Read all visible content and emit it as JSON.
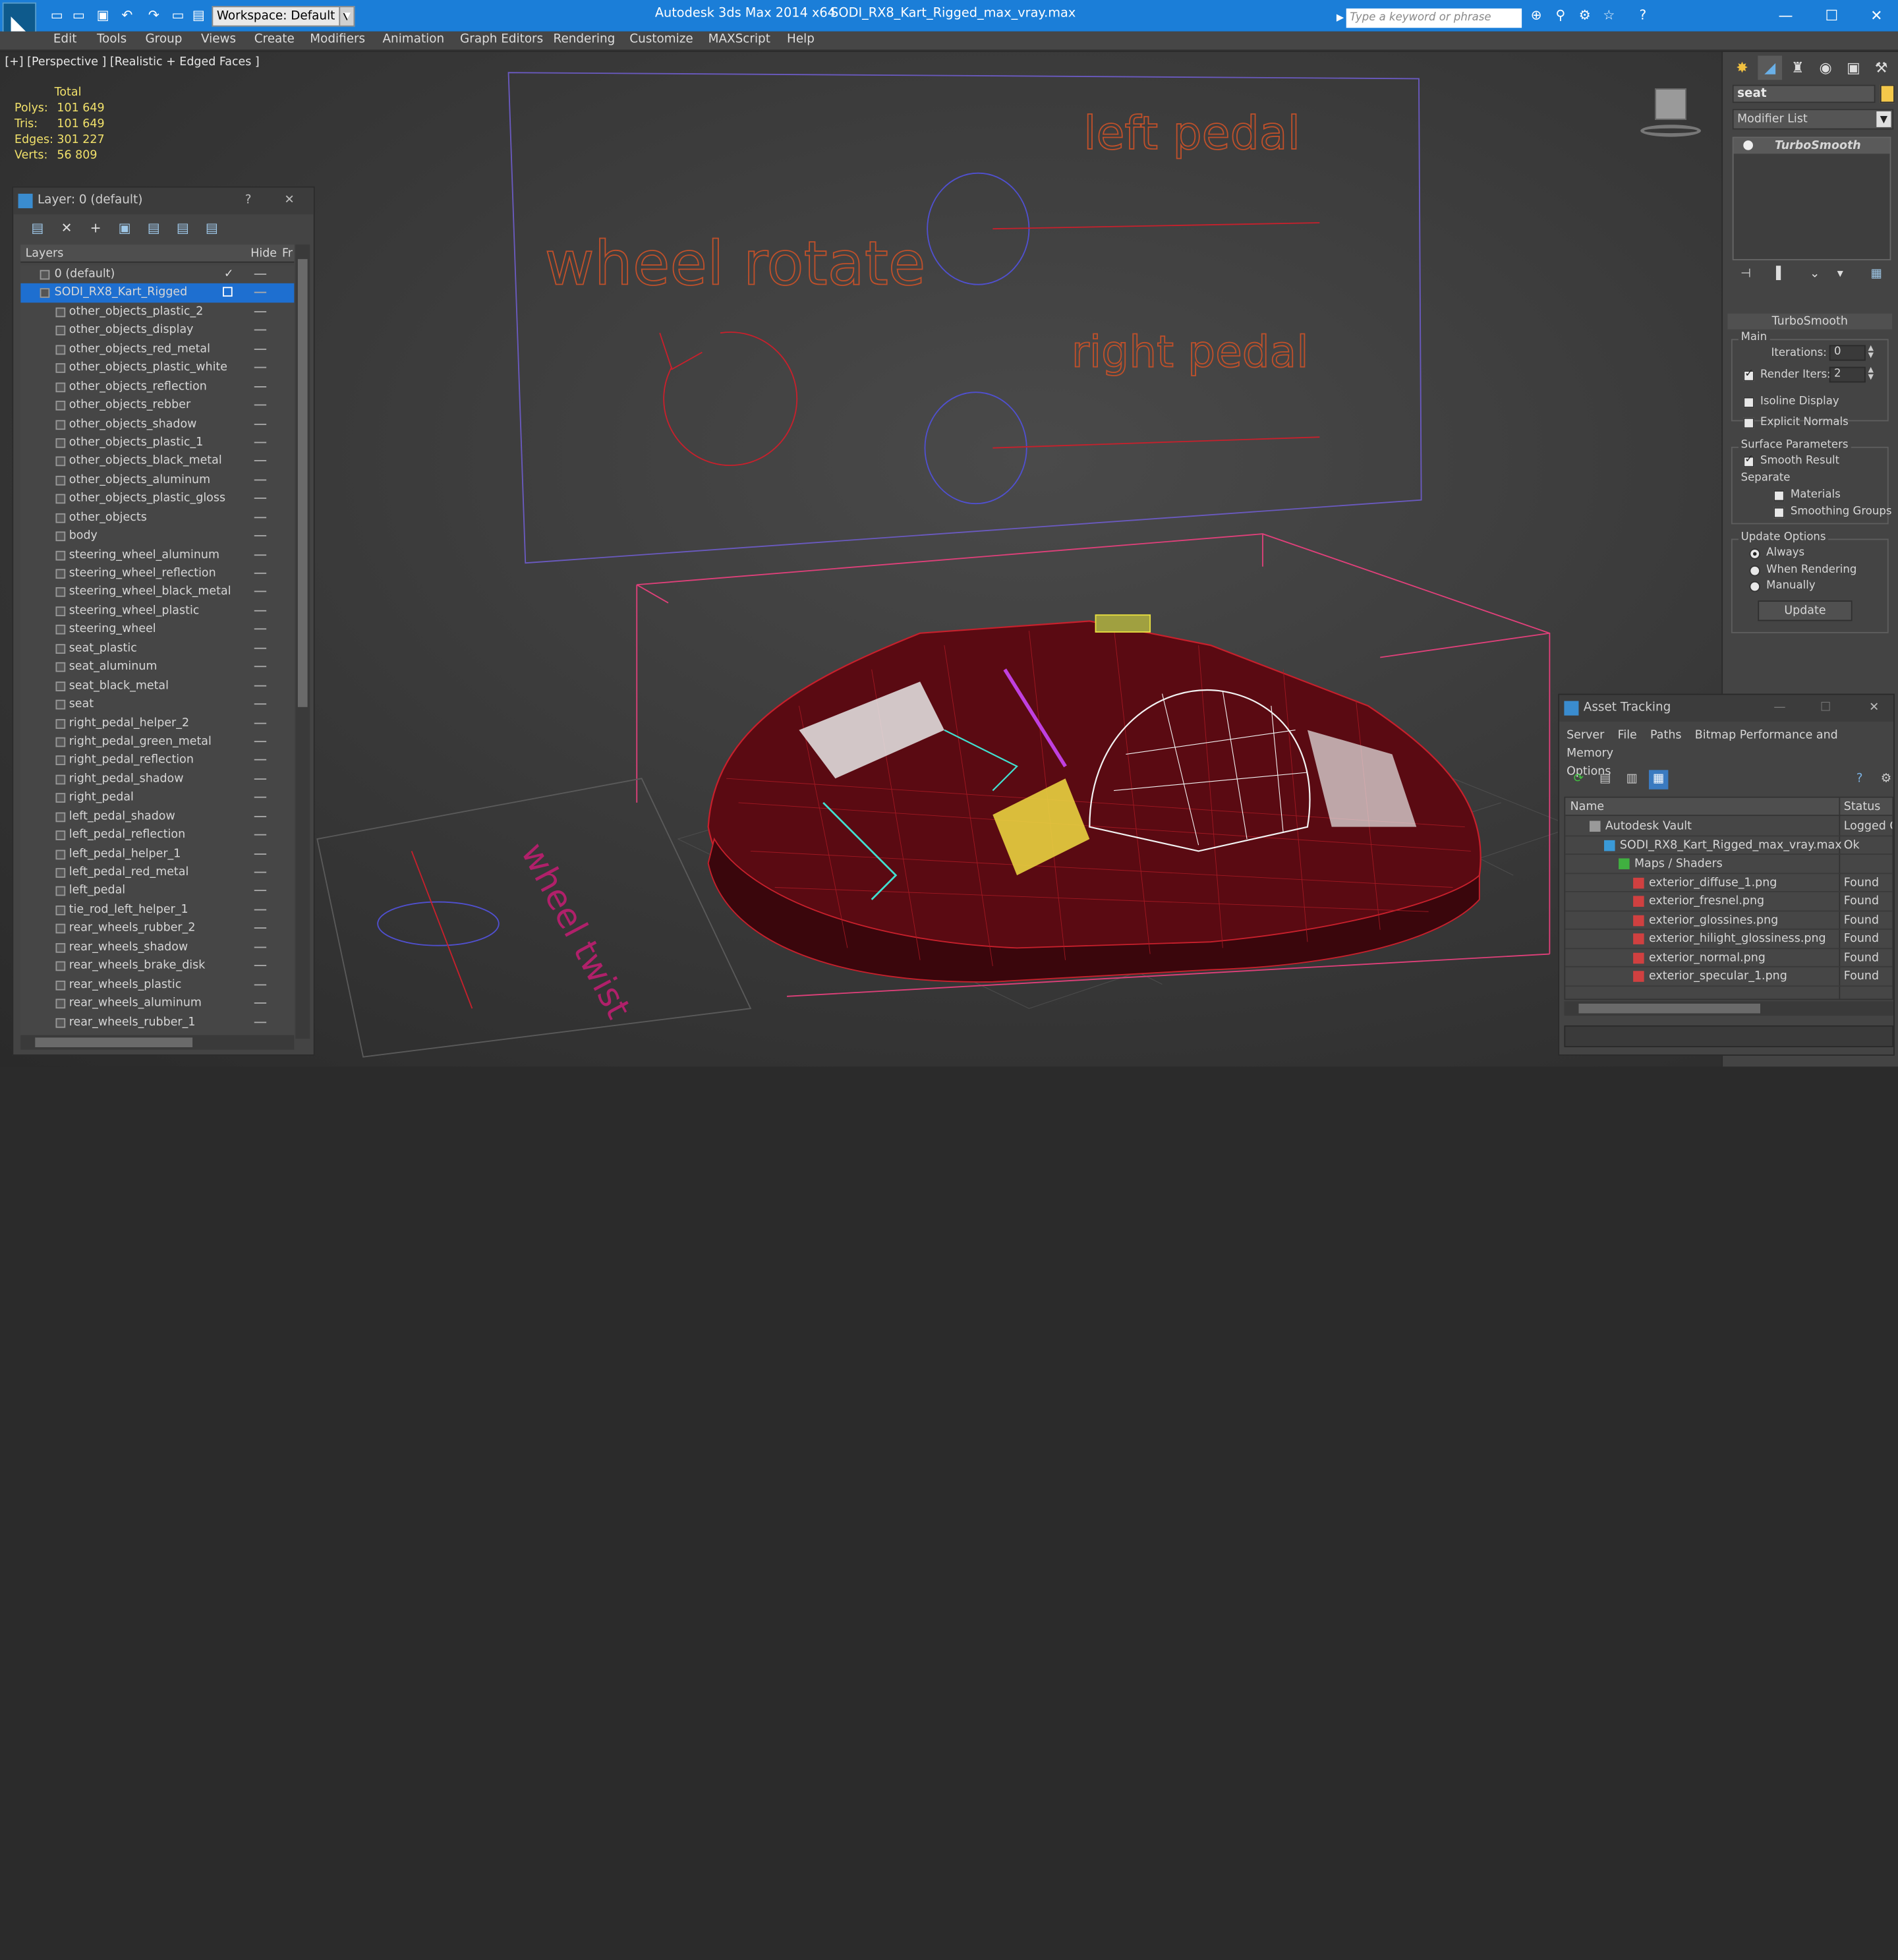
{
  "app": {
    "title": "Autodesk 3ds Max  2014 x64",
    "file": "SODI_RX8_Kart_Rigged_max_vray.max",
    "workspace": "Workspace: Default",
    "search_placeholder": "Type a keyword or phrase"
  },
  "menu": [
    "Edit",
    "Tools",
    "Group",
    "Views",
    "Create",
    "Modifiers",
    "Animation",
    "Graph Editors",
    "Rendering",
    "Customize",
    "MAXScript",
    "Help"
  ],
  "viewport": {
    "label": "[+] [Perspective ] [Realistic + Edged Faces ]",
    "stats_header": "Total",
    "stats": [
      {
        "label": "Polys:",
        "value": "101 649"
      },
      {
        "label": "Tris:",
        "value": "101 649"
      },
      {
        "label": "Edges:",
        "value": "301 227"
      },
      {
        "label": "Verts:",
        "value": "56 809"
      }
    ],
    "rig_labels": {
      "left_pedal": "left pedal",
      "right_pedal": "right pedal",
      "wheel_rotate": "wheel rotate",
      "floor_text": "wheel twist"
    }
  },
  "layer_panel": {
    "title": "Layer: 0 (default)",
    "help": "?",
    "col_layers": "Layers",
    "col_hide": "Hide",
    "col_freeze": "Fr",
    "layers": [
      {
        "name": "0 (default)",
        "level": 0,
        "current": true
      },
      {
        "name": "SODI_RX8_Kart_Rigged",
        "level": 0,
        "selected": true
      },
      {
        "name": "other_objects_plastic_2",
        "level": 1
      },
      {
        "name": "other_objects_display",
        "level": 1
      },
      {
        "name": "other_objects_red_metal",
        "level": 1
      },
      {
        "name": "other_objects_plastic_white",
        "level": 1
      },
      {
        "name": "other_objects_reflection",
        "level": 1
      },
      {
        "name": "other_objects_rebber",
        "level": 1
      },
      {
        "name": "other_objects_shadow",
        "level": 1
      },
      {
        "name": "other_objects_plastic_1",
        "level": 1
      },
      {
        "name": "other_objects_black_metal",
        "level": 1
      },
      {
        "name": "other_objects_aluminum",
        "level": 1
      },
      {
        "name": "other_objects_plastic_gloss",
        "level": 1
      },
      {
        "name": "other_objects",
        "level": 1
      },
      {
        "name": "body",
        "level": 1
      },
      {
        "name": "steering_wheel_aluminum",
        "level": 1
      },
      {
        "name": "steering_wheel_reflection",
        "level": 1
      },
      {
        "name": "steering_wheel_black_metal",
        "level": 1
      },
      {
        "name": "steering_wheel_plastic",
        "level": 1
      },
      {
        "name": "steering_wheel",
        "level": 1
      },
      {
        "name": "seat_plastic",
        "level": 1
      },
      {
        "name": "seat_aluminum",
        "level": 1
      },
      {
        "name": "seat_black_metal",
        "level": 1
      },
      {
        "name": "seat",
        "level": 1
      },
      {
        "name": "right_pedal_helper_2",
        "level": 1
      },
      {
        "name": "right_pedal_green_metal",
        "level": 1
      },
      {
        "name": "right_pedal_reflection",
        "level": 1
      },
      {
        "name": "right_pedal_shadow",
        "level": 1
      },
      {
        "name": "right_pedal",
        "level": 1
      },
      {
        "name": "left_pedal_shadow",
        "level": 1
      },
      {
        "name": "left_pedal_reflection",
        "level": 1
      },
      {
        "name": "left_pedal_helper_1",
        "level": 1
      },
      {
        "name": "left_pedal_red_metal",
        "level": 1
      },
      {
        "name": "left_pedal",
        "level": 1
      },
      {
        "name": "tie_rod_left_helper_1",
        "level": 1
      },
      {
        "name": "rear_wheels_rubber_2",
        "level": 1
      },
      {
        "name": "rear_wheels_shadow",
        "level": 1
      },
      {
        "name": "rear_wheels_brake_disk",
        "level": 1
      },
      {
        "name": "rear_wheels_plastic",
        "level": 1
      },
      {
        "name": "rear_wheels_aluminum",
        "level": 1
      },
      {
        "name": "rear_wheels_rubber_1",
        "level": 1
      }
    ]
  },
  "command_panel": {
    "object_name": "seat",
    "modifier_list": "Modifier List",
    "stack_item": "TurboSmooth",
    "rollout_title": "TurboSmooth",
    "main_label": "Main",
    "iterations_label": "Iterations:",
    "iterations_value": "0",
    "render_iters_label": "Render Iters:",
    "render_iters_value": "2",
    "isoline_label": "Isoline Display",
    "explicit_normals_label": "Explicit Normals",
    "surface_params_label": "Surface Parameters",
    "smooth_result_label": "Smooth Result",
    "separate_label": "Separate",
    "materials_label": "Materials",
    "smoothing_groups_label": "Smoothing Groups",
    "update_options_label": "Update Options",
    "always_label": "Always",
    "when_rendering_label": "When Rendering",
    "manually_label": "Manually",
    "update_button": "Update"
  },
  "asset_panel": {
    "title": "Asset Tracking",
    "menu": [
      "Server",
      "File",
      "Paths",
      "Bitmap Performance and Memory"
    ],
    "menu2": "Options",
    "col_name": "Name",
    "col_status": "Status",
    "rows": [
      {
        "name": "Autodesk Vault",
        "status": "Logged O",
        "level": 0,
        "kind": "vault"
      },
      {
        "name": "SODI_RX8_Kart_Rigged_max_vray.max",
        "status": "Ok",
        "level": 1,
        "kind": "max"
      },
      {
        "name": "Maps / Shaders",
        "status": "",
        "level": 2,
        "kind": "folder"
      },
      {
        "name": "exterior_diffuse_1.png",
        "status": "Found",
        "level": 3,
        "kind": "png"
      },
      {
        "name": "exterior_fresnel.png",
        "status": "Found",
        "level": 3,
        "kind": "png"
      },
      {
        "name": "exterior_glossines.png",
        "status": "Found",
        "level": 3,
        "kind": "png"
      },
      {
        "name": "exterior_hilight_glossiness.png",
        "status": "Found",
        "level": 3,
        "kind": "png"
      },
      {
        "name": "exterior_normal.png",
        "status": "Found",
        "level": 3,
        "kind": "png"
      },
      {
        "name": "exterior_specular_1.png",
        "status": "Found",
        "level": 3,
        "kind": "png"
      }
    ]
  },
  "colors": {
    "titlebar": "#1b7ed8",
    "selection": "#1e6fd0",
    "rig_text": "#c0502a",
    "wire_red": "#c8202c",
    "helper_pink": "#e0407a",
    "helper_blue": "#5050d0"
  }
}
